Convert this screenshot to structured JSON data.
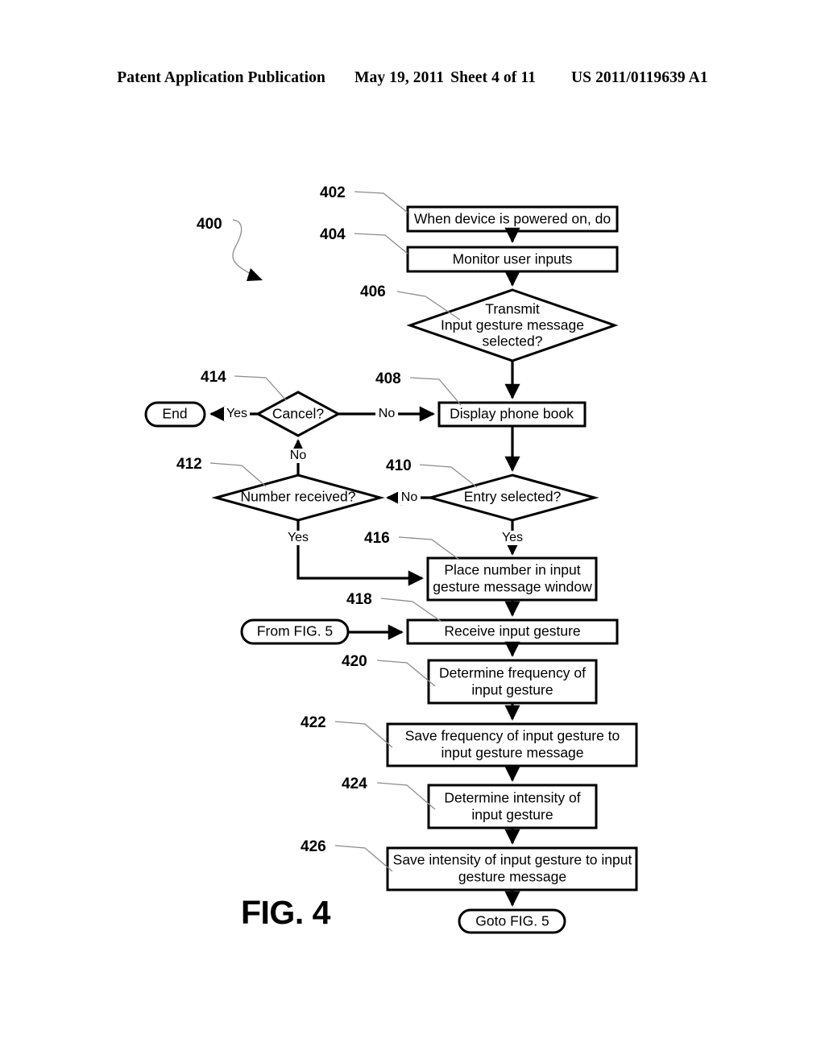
{
  "header": {
    "publication": "Patent Application Publication",
    "date": "May 19, 2011",
    "sheet": "Sheet 4 of 11",
    "patent_number": "US 2011/0119639 A1"
  },
  "figure": {
    "caption": "FIG. 4",
    "diagram_ref": "400"
  },
  "nodes": [
    {
      "ref": "402",
      "shape": "process",
      "text_lines": [
        "When device is powered on, do"
      ]
    },
    {
      "ref": "404",
      "shape": "process",
      "text_lines": [
        "Monitor user inputs"
      ]
    },
    {
      "ref": "406",
      "shape": "decision",
      "text_lines": [
        "Transmit",
        "Input gesture message",
        "selected?"
      ]
    },
    {
      "ref": "408",
      "shape": "process",
      "text_lines": [
        "Display phone book"
      ]
    },
    {
      "ref": "410",
      "shape": "decision",
      "text_lines": [
        "Entry selected?"
      ]
    },
    {
      "ref": "412",
      "shape": "decision",
      "text_lines": [
        "Number received?"
      ]
    },
    {
      "ref": "414",
      "shape": "decision",
      "text_lines": [
        "Cancel?"
      ]
    },
    {
      "ref": "416",
      "shape": "process",
      "text_lines": [
        "Place number in input",
        "gesture message window"
      ]
    },
    {
      "ref": "418",
      "shape": "process",
      "text_lines": [
        "Receive input gesture"
      ]
    },
    {
      "ref": "420",
      "shape": "process",
      "text_lines": [
        "Determine frequency of",
        "input gesture"
      ]
    },
    {
      "ref": "422",
      "shape": "process",
      "text_lines": [
        "Save frequency of input gesture to",
        "input gesture message"
      ]
    },
    {
      "ref": "424",
      "shape": "process",
      "text_lines": [
        "Determine intensity of",
        "input gesture"
      ]
    },
    {
      "ref": "426",
      "shape": "process",
      "text_lines": [
        "Save intensity of input gesture to input",
        "gesture message"
      ]
    }
  ],
  "terminators": [
    {
      "id": "end",
      "text": "End"
    },
    {
      "id": "from-fig5",
      "text": "From FIG. 5"
    },
    {
      "id": "goto-fig5",
      "text": "Goto FIG. 5"
    }
  ],
  "edge_labels": {
    "cancel_yes": "Yes",
    "cancel_no": "No",
    "number_received_no": "No",
    "entry_selected_no": "No",
    "number_received_yes": "Yes",
    "entry_selected_yes": "Yes"
  },
  "colors": {
    "ink": "#000000",
    "paper": "#ffffff",
    "leader": "#8c8c8c"
  }
}
